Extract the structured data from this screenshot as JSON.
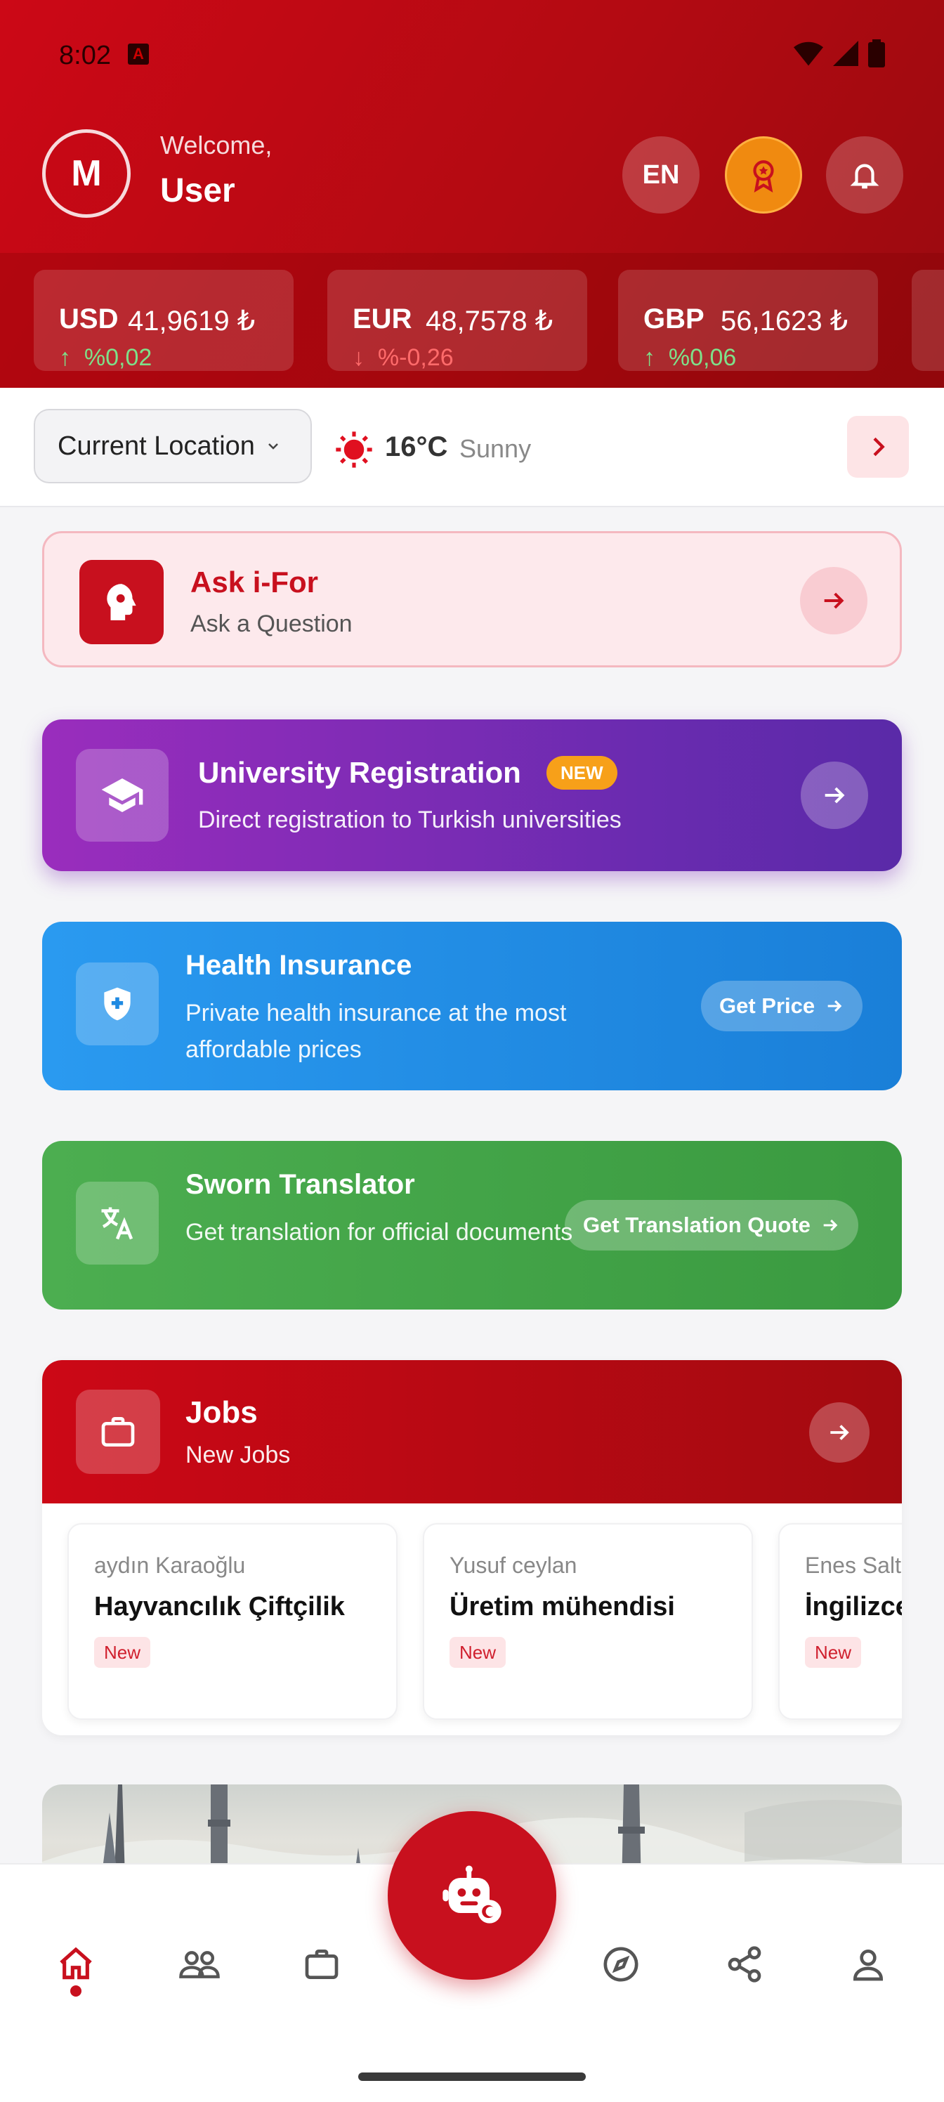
{
  "status_bar": {
    "time": "8:02"
  },
  "header": {
    "avatar_initial": "M",
    "welcome": "Welcome,",
    "username": "User",
    "language": "EN"
  },
  "currencies": [
    {
      "code": "USD",
      "value": "41,9619 ₺",
      "change": "%0,02",
      "direction": "up"
    },
    {
      "code": "EUR",
      "value": "48,7578 ₺",
      "change": "%-0,26",
      "direction": "down"
    },
    {
      "code": "GBP",
      "value": "56,1623 ₺",
      "change": "%0,06",
      "direction": "up"
    }
  ],
  "location": {
    "selector_label": "Current Location",
    "temperature": "16°C",
    "condition": "Sunny"
  },
  "ask": {
    "title": "Ask i-For",
    "subtitle": "Ask a Question"
  },
  "university": {
    "title": "University Registration",
    "badge": "NEW",
    "subtitle": "Direct registration to Turkish universities"
  },
  "health": {
    "title": "Health Insurance",
    "subtitle": "Private health insurance at the most affordable prices",
    "button": "Get Price"
  },
  "sworn": {
    "title": "Sworn Translator",
    "subtitle": "Get translation for official documents",
    "button": "Get Translation Quote"
  },
  "jobs": {
    "title": "Jobs",
    "subtitle": "New Jobs",
    "items": [
      {
        "poster": "aydın Karaoğlu",
        "role": "Hayvancılık  Çiftçilik",
        "badge": "New"
      },
      {
        "poster": "Yusuf ceylan",
        "role": "Üretim mühendisi",
        "badge": "New"
      },
      {
        "poster": "Enes Salt",
        "role": "İngilizce",
        "badge": "New"
      }
    ]
  },
  "colors": {
    "brand_red": "#c8101e",
    "university_purple": "#7a2bb5",
    "health_blue": "#1f8ae2",
    "sworn_green": "#46a64a",
    "badge_orange": "#f7a019"
  },
  "nav": {
    "items": [
      "home-icon",
      "community-icon",
      "briefcase-icon",
      "compass-icon",
      "share-icon",
      "profile-icon"
    ],
    "fab_icon": "robot-assistant-icon"
  }
}
